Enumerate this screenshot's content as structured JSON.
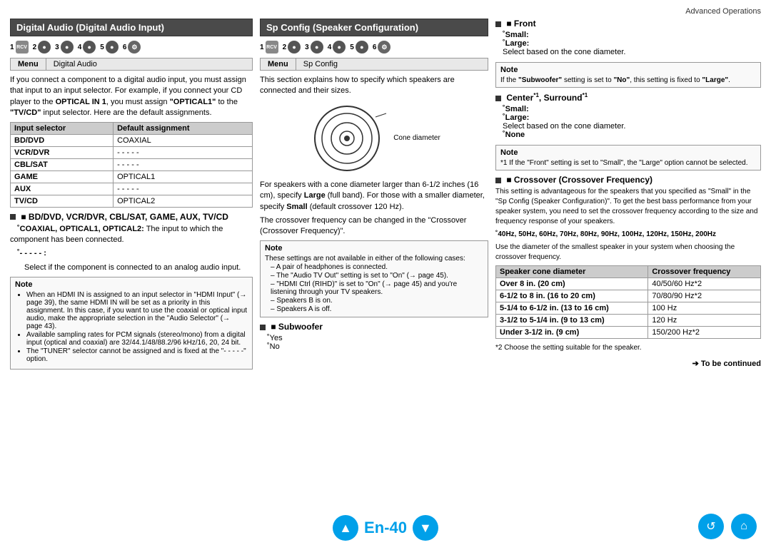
{
  "page": {
    "top_label": "Advanced Operations",
    "page_number": "En-40",
    "to_be_continued": "➔ To be continued"
  },
  "left_section": {
    "title": "Digital Audio (Digital Audio Input)",
    "steps": [
      "1",
      "2",
      "3",
      "4",
      "5",
      "6"
    ],
    "menu_bar": {
      "left": "Menu",
      "right": "Digital Audio"
    },
    "intro_text": "If you connect a component to a digital audio input, you must assign that input to an input selector. For example, if you connect your CD player to the OPTICAL IN 1, you must assign \"OPTICAL1\" to the \"TV/CD\" input selector. Here are the default assignments.",
    "table": {
      "headers": [
        "Input selector",
        "Default assignment"
      ],
      "rows": [
        [
          "BD/DVD",
          "COAXIAL"
        ],
        [
          "VCR/DVR",
          "- - - - -"
        ],
        [
          "CBL/SAT",
          "- - - - -"
        ],
        [
          "GAME",
          "OPTICAL1"
        ],
        [
          "AUX",
          "- - - - -"
        ],
        [
          "TV/CD",
          "OPTICAL2"
        ]
      ]
    },
    "subsection_title": "■ BD/DVD, VCR/DVR, CBL/SAT, GAME, AUX, TV/CD",
    "coaxial_label": "˚COAXIAL, OPTICAL1, OPTICAL2:",
    "coaxial_text": "The input to which the component has been connected.",
    "dash_label": "˚- - - - - :",
    "dash_text": "Select if the component is connected to an analog audio input.",
    "note": {
      "title": "Note",
      "bullets": [
        "When an HDMI IN is assigned to an input selector in \"HDMI Input\" (→ page 39), the same HDMI IN will be set as a priority in this assignment. In this case, if you want to use the coaxial or optical input audio, make the appropriate selection in the \"Audio Selector\" (→ page 43).",
        "Available sampling rates for PCM signals (stereo/mono) from a digital input (optical and coaxial) are 32/44.1/48/88.2/96 kHz/16, 20, 24 bit.",
        "The \"TUNER\" selector cannot be assigned and is fixed at the \"- - - - -\" option."
      ]
    }
  },
  "mid_section": {
    "title": "Sp Config (Speaker Configuration)",
    "steps": [
      "1",
      "2",
      "3",
      "4",
      "5",
      "6"
    ],
    "menu_bar": {
      "left": "Menu",
      "right": "Sp Config"
    },
    "intro_text": "This section explains how to specify which speakers are connected and their sizes.",
    "cone_label": "Cone diameter",
    "cone_text1": "For speakers with a cone diameter larger than 6-1/2 inches (16 cm), specify Large (full band). For those with a smaller diameter, specify Small (default crossover 120 Hz).",
    "cone_text2": "The crossover frequency can be changed in the \"Crossover (Crossover Frequency)\".",
    "note": {
      "title": "Note",
      "items": [
        "These settings are not available in either of the following cases:",
        "– A pair of headphones is connected.",
        "– The \"Audio TV Out\" setting is set to \"On\" (→ page 45).",
        "– \"HDMI Ctrl (RIHD)\" is set to \"On\" (→ page 45) and you're listening through your TV speakers.",
        "– Speakers B is on.",
        "– Speakers A is off."
      ]
    },
    "subwoofer": {
      "title": "■ Subwoofer",
      "yes": "˚Yes",
      "no": "˚No"
    }
  },
  "right_section": {
    "front": {
      "title": "■ Front",
      "small_label": "˚Small:",
      "large_label": "˚Large:",
      "select_text": "Select based on the cone diameter."
    },
    "note1": {
      "title": "Note",
      "text": "If the \"Subwoofer\" setting is set to \"No\", this setting is fixed to \"Large\"."
    },
    "center_surround": {
      "title": "■ Center",
      "title_sup": "*1",
      "title2": ", Surround",
      "title2_sup": "*1",
      "small_label": "˚Small:",
      "large_label": "˚Large:",
      "select_text": "Select based on the cone diameter.",
      "none_label": "˚None"
    },
    "note2": {
      "title": "Note",
      "text": "*1 If the \"Front\" setting is set to \"Small\", the \"Large\" option cannot be selected."
    },
    "crossover": {
      "title": "■ Crossover (Crossover Frequency)",
      "intro": "This setting is advantageous for the speakers that you specified as \"Small\" in the \"Sp Config (Speaker Configuration)\". To get the best bass performance from your speaker system, you need to set the crossover frequency according to the size and frequency response of your speakers.",
      "freq_label": "˚40Hz, 50Hz, 60Hz, 70Hz, 80Hz, 90Hz, 100Hz, 120Hz, 150Hz, 200Hz",
      "use_text": "Use the diameter of the smallest speaker in your system when choosing the crossover frequency.",
      "table": {
        "headers": [
          "Speaker cone diameter",
          "Crossover frequency"
        ],
        "rows": [
          [
            "Over 8 in. (20 cm)",
            "40/50/60 Hz*2"
          ],
          [
            "6-1/2 to 8 in. (16 to 20 cm)",
            "70/80/90 Hz*2"
          ],
          [
            "5-1/4 to 6-1/2 in. (13 to 16 cm)",
            "100 Hz"
          ],
          [
            "3-1/2 to 5-1/4 in. (9 to 13 cm)",
            "120 Hz"
          ],
          [
            "Under 3-1/2 in. (9 cm)",
            "150/200 Hz*2"
          ]
        ]
      },
      "footnote": "*2 Choose the setting suitable for the speaker."
    }
  },
  "footer": {
    "page_label": "En-40",
    "to_be_continued": "➔ To be continued"
  }
}
